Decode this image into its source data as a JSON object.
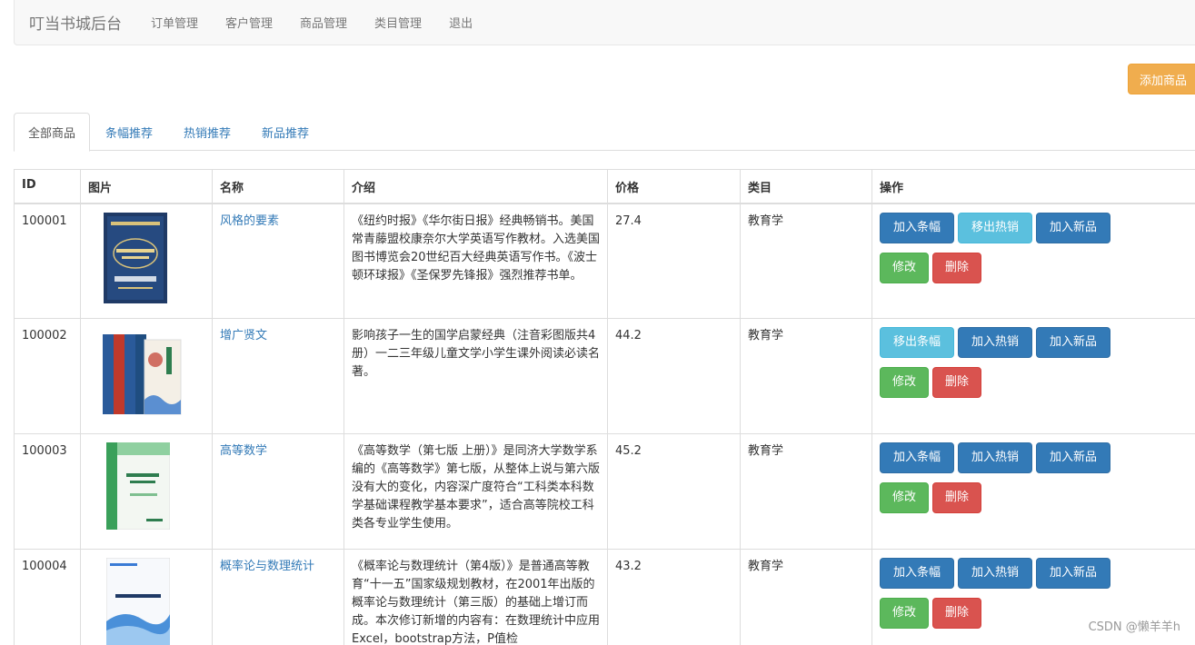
{
  "navbar": {
    "brand": "叮当书城后台",
    "links": [
      "订单管理",
      "客户管理",
      "商品管理",
      "类目管理",
      "退出"
    ]
  },
  "add_button": "添加商品",
  "tabs": [
    "全部商品",
    "条幅推荐",
    "热销推荐",
    "新品推荐"
  ],
  "table": {
    "headers": [
      "ID",
      "图片",
      "名称",
      "介绍",
      "价格",
      "类目",
      "操作"
    ],
    "rows": [
      {
        "id": "100001",
        "name": "风格的要素",
        "intro": "《纽约时报》《华尔街日报》经典畅销书。美国常青藤盟校康奈尔大学英语写作教材。入选美国图书博览会20世纪百大经典英语写作书。《波士顿环球报》《圣保罗先锋报》强烈推荐书单。",
        "price": "27.4",
        "category": "教育学",
        "actions": [
          "加入条幅",
          "移出热销",
          "加入新品",
          "修改",
          "删除"
        ]
      },
      {
        "id": "100002",
        "name": "增广贤文",
        "intro": "影响孩子一生的国学启蒙经典（注音彩图版共4册）一二三年级儿童文学小学生课外阅读必读名著。",
        "price": "44.2",
        "category": "教育学",
        "actions": [
          "移出条幅",
          "加入热销",
          "加入新品",
          "修改",
          "删除"
        ]
      },
      {
        "id": "100003",
        "name": "高等数学",
        "intro": "《高等数学（第七版 上册）》是同济大学数学系编的《高等数学》第七版，从整体上说与第六版没有大的变化，内容深广度符合“工科类本科数学基础课程教学基本要求”，适合高等院校工科类各专业学生使用。",
        "price": "45.2",
        "category": "教育学",
        "actions": [
          "加入条幅",
          "加入热销",
          "加入新品",
          "修改",
          "删除"
        ]
      },
      {
        "id": "100004",
        "name": "概率论与数理统计",
        "intro": "《概率论与数理统计（第4版）》是普通高等教育“十一五”国家级规划教材，在2001年出版的概率论与数理统计（第三版）的基础上增订而成。本次修订新增的内容有：在数理统计中应用Excel，bootstrap方法，P值检",
        "price": "43.2",
        "category": "教育学",
        "actions": [
          "加入条幅",
          "加入热销",
          "加入新品",
          "修改",
          "删除"
        ]
      }
    ]
  },
  "watermark": "CSDN @懒羊羊h",
  "colors": {
    "primary": "#337ab7",
    "info": "#5bc0de",
    "success": "#5cb85c",
    "danger": "#d9534f",
    "warning": "#f0ad4e"
  }
}
